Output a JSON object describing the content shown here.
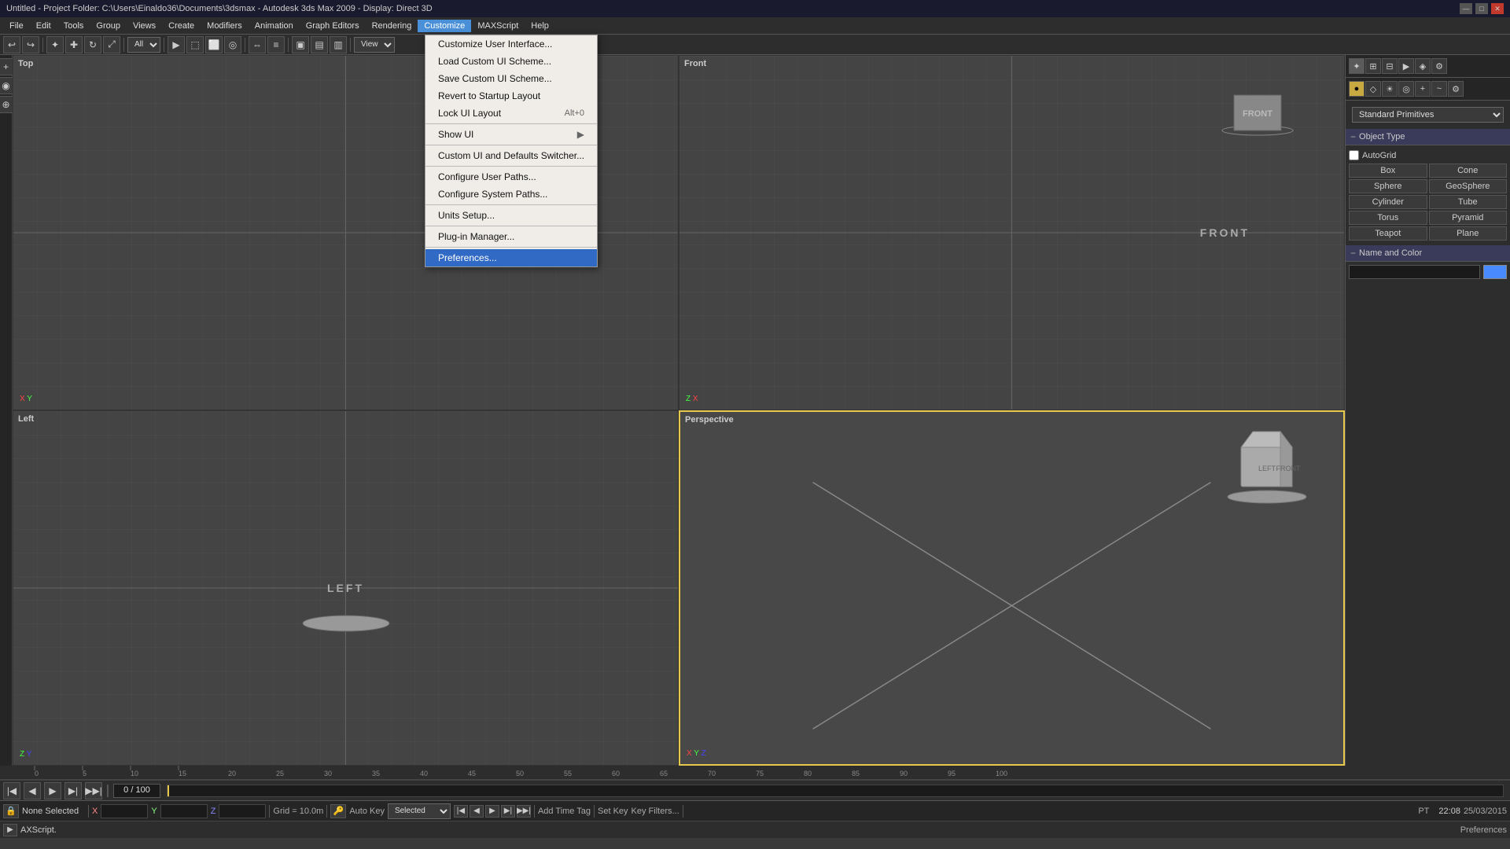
{
  "titlebar": {
    "title": "Untitled - Project Folder: C:\\Users\\Einaldo36\\Documents\\3dsmax - Autodesk 3ds Max 2009 - Display: Direct 3D",
    "win_controls": [
      "—",
      "□",
      "✕"
    ]
  },
  "menubar": {
    "items": [
      "File",
      "Edit",
      "Tools",
      "Group",
      "Views",
      "Create",
      "Modifiers",
      "Animation",
      "Graph Editors",
      "Rendering",
      "Customize",
      "MAXScript",
      "Help"
    ]
  },
  "toolbar": {
    "active_menu": "Customize",
    "view_label": "View",
    "all_label": "All"
  },
  "customize_menu": {
    "items": [
      {
        "label": "Customize User Interface...",
        "shortcut": "",
        "separator_after": false,
        "arrow": false
      },
      {
        "label": "Load Custom UI Scheme...",
        "shortcut": "",
        "separator_after": false,
        "arrow": false
      },
      {
        "label": "Save Custom UI Scheme...",
        "shortcut": "",
        "separator_after": false,
        "arrow": false
      },
      {
        "label": "Revert to Startup Layout",
        "shortcut": "",
        "separator_after": false,
        "arrow": false
      },
      {
        "label": "Lock UI Layout",
        "shortcut": "Alt+0",
        "separator_after": true,
        "arrow": false
      },
      {
        "label": "Show UI",
        "shortcut": "",
        "separator_after": true,
        "arrow": true
      },
      {
        "label": "Custom UI and Defaults Switcher...",
        "shortcut": "",
        "separator_after": true,
        "arrow": false
      },
      {
        "label": "Configure User Paths...",
        "shortcut": "",
        "separator_after": false,
        "arrow": false
      },
      {
        "label": "Configure System Paths...",
        "shortcut": "",
        "separator_after": true,
        "arrow": false
      },
      {
        "label": "Units Setup...",
        "shortcut": "",
        "separator_after": true,
        "arrow": false
      },
      {
        "label": "Plug-in Manager...",
        "shortcut": "",
        "separator_after": true,
        "arrow": false
      },
      {
        "label": "Preferences...",
        "shortcut": "",
        "separator_after": false,
        "arrow": false,
        "highlighted": true
      }
    ]
  },
  "viewports": {
    "top": {
      "label": "Top",
      "active": false
    },
    "front": {
      "label": "Front",
      "active": false
    },
    "left": {
      "label": "Left",
      "active": false
    },
    "perspective": {
      "label": "Perspective",
      "active": true
    }
  },
  "right_panel": {
    "primitives_dropdown": "Standard Primitives",
    "object_type_header": "Object Type",
    "autodef_label": "AutoGrid",
    "primitives": [
      "Box",
      "Cone",
      "Sphere",
      "GeoSphere",
      "Cylinder",
      "Tube",
      "Torus",
      "Pyramid",
      "Teapot",
      "Plane"
    ],
    "name_color_header": "Name and Color"
  },
  "timeline": {
    "current_frame": "0 / 100"
  },
  "statusbar": {
    "none_selected": "None Selected",
    "x_label": "X",
    "y_label": "Y",
    "z_label": "Z",
    "x_val": "",
    "y_val": "",
    "z_val": "",
    "grid_label": "Grid = 10.0m",
    "autokey_label": "Auto Key",
    "selected_label": "Selected",
    "key_filters": "Key Filters...",
    "add_time_tag": "Add Time Tag",
    "set_key_label": "Set Key"
  },
  "scriptbar": {
    "text": "AXScript.",
    "preferences": "Preferences"
  },
  "clock": {
    "time": "22:08",
    "date": "25/03/2015"
  }
}
